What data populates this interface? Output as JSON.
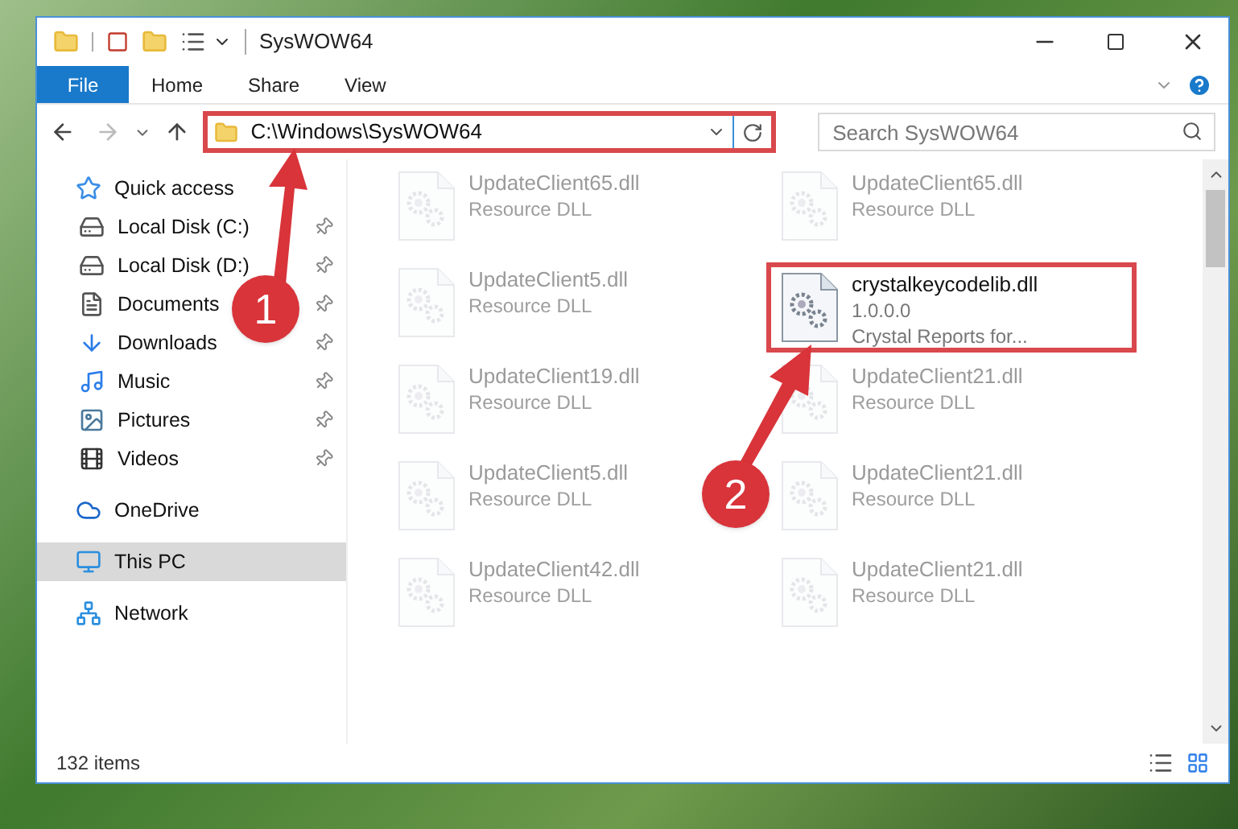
{
  "window": {
    "title": "SysWOW64"
  },
  "ribbon_tabs": [
    {
      "label": "File",
      "selected": true
    },
    {
      "label": "Home",
      "selected": false
    },
    {
      "label": "Share",
      "selected": false
    },
    {
      "label": "View",
      "selected": false
    }
  ],
  "address_bar": {
    "path": "C:\\Windows\\SysWOW64",
    "highlighted": true
  },
  "search": {
    "placeholder": "Search SysWOW64"
  },
  "sidebar": {
    "items": [
      {
        "label": "Quick access",
        "kind": "star",
        "pinned": false,
        "selected": false,
        "children": [
          {
            "label": "Local Disk (C:)",
            "kind": "drive",
            "pinned": true,
            "selected": false
          },
          {
            "label": "Local Disk (D:)",
            "kind": "drive",
            "pinned": true,
            "selected": false
          },
          {
            "label": "Documents",
            "kind": "document",
            "pinned": true,
            "selected": false
          },
          {
            "label": "Downloads",
            "kind": "download",
            "pinned": true,
            "selected": false
          },
          {
            "label": "Music",
            "kind": "music",
            "pinned": true,
            "selected": false
          },
          {
            "label": "Pictures",
            "kind": "picture",
            "pinned": true,
            "selected": false
          },
          {
            "label": "Videos",
            "kind": "video",
            "pinned": true,
            "selected": false
          }
        ]
      },
      {
        "label": "OneDrive",
        "kind": "cloud",
        "pinned": false,
        "selected": false
      },
      {
        "label": "This PC",
        "kind": "computer",
        "pinned": false,
        "selected": true
      },
      {
        "label": "Network",
        "kind": "network",
        "pinned": false,
        "selected": false
      }
    ]
  },
  "files": [
    {
      "name": "UpdateClient65.dll",
      "lines": [
        "Resource DLL"
      ],
      "faded": true,
      "highlighted": false
    },
    {
      "name": "UpdateClient65.dll",
      "lines": [
        "Resource DLL"
      ],
      "faded": true,
      "highlighted": false
    },
    {
      "name": "UpdateClient5.dll",
      "lines": [
        "Resource DLL"
      ],
      "faded": true,
      "highlighted": false
    },
    {
      "name": "crystalkeycodelib.dll",
      "lines": [
        "1.0.0.0",
        "Crystal Reports for..."
      ],
      "faded": false,
      "highlighted": true
    },
    {
      "name": "UpdateClient19.dll",
      "lines": [
        "Resource DLL"
      ],
      "faded": true,
      "highlighted": false
    },
    {
      "name": "UpdateClient21.dll",
      "lines": [
        "Resource DLL"
      ],
      "faded": true,
      "highlighted": false
    },
    {
      "name": "UpdateClient5.dll",
      "lines": [
        "Resource DLL"
      ],
      "faded": true,
      "highlighted": false
    },
    {
      "name": "UpdateClient21.dll",
      "lines": [
        "Resource DLL"
      ],
      "faded": true,
      "highlighted": false
    },
    {
      "name": "UpdateClient42.dll",
      "lines": [
        "Resource DLL"
      ],
      "faded": true,
      "highlighted": false
    },
    {
      "name": "UpdateClient21.dll",
      "lines": [
        "Resource DLL"
      ],
      "faded": true,
      "highlighted": false
    }
  ],
  "status_bar": {
    "item_count": "132 items"
  },
  "annotations": [
    {
      "number": "1"
    },
    {
      "number": "2"
    }
  ]
}
